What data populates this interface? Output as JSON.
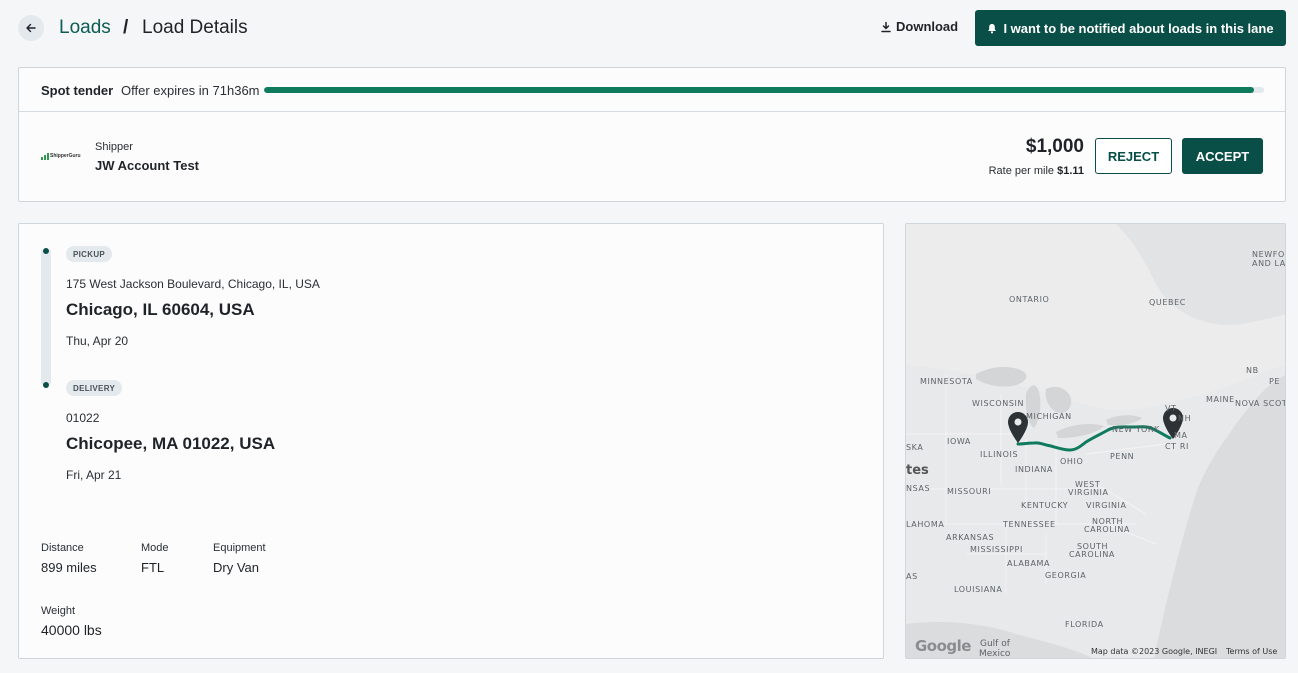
{
  "header": {
    "breadcrumb_loads": "Loads",
    "breadcrumb_separator": "/",
    "breadcrumb_current": "Load Details",
    "download_label": "Download",
    "notify_label": "I want to be notified about loads in this lane"
  },
  "tender": {
    "label": "Spot tender",
    "expires_text": "Offer expires in 71h36m",
    "progress_fraction": 0.99
  },
  "offer": {
    "shipper_caption": "Shipper",
    "shipper_name": "JW Account Test",
    "shipper_logo_text": "ShipperGuru",
    "price": "$1,000",
    "rate_label": "Rate per mile",
    "rate_value": "$1.11",
    "reject_label": "REJECT",
    "accept_label": "ACCEPT"
  },
  "stops": {
    "pickup": {
      "badge": "PICKUP",
      "address": "175 West Jackson Boulevard, Chicago, IL, USA",
      "city": "Chicago, IL 60604, USA",
      "date": "Thu, Apr 20"
    },
    "delivery": {
      "badge": "DELIVERY",
      "address": "01022",
      "city": "Chicopee, MA 01022, USA",
      "date": "Fri, Apr 21"
    }
  },
  "meta": {
    "distance_label": "Distance",
    "distance_value": "899 miles",
    "mode_label": "Mode",
    "mode_value": "FTL",
    "equipment_label": "Equipment",
    "equipment_value": "Dry Van",
    "weight_label": "Weight",
    "weight_value": "40000 lbs"
  },
  "map": {
    "labels": {
      "ontario": "ONTARIO",
      "quebec": "QUEBEC",
      "newfo": "NEWFO",
      "and_la": "AND LA",
      "minnesota": "MINNESOTA",
      "nb": "NB",
      "pe": "PE",
      "maine": "MAINE",
      "nova_scot": "NOVA SCOT",
      "wisconsin": "WISCONSIN",
      "michigan": "MICHIGAN",
      "vt": "VT",
      "nh": "NH",
      "new_york": "NEW YORK",
      "ma": "MA",
      "ska": "SKA",
      "iowa": "IOWA",
      "illinois": "ILLINOIS",
      "ohio": "OHIO",
      "penn": "PENN",
      "ct_ri": "CT RI",
      "tes": "tes",
      "indiana": "INDIANA",
      "nsas": "NSAS",
      "missouri": "MISSOURI",
      "west_virginia_1": "WEST",
      "west_virginia_2": "VIRGINIA",
      "kentucky": "KENTUCKY",
      "virginia": "VIRGINIA",
      "lahoma": "LAHOMA",
      "tennessee": "TENNESSEE",
      "north_carolina_1": "NORTH",
      "north_carolina_2": "CAROLINA",
      "arkansas": "ARKANSAS",
      "mississippi": "MISSISSIPPI",
      "south_carolina_1": "SOUTH",
      "south_carolina_2": "CAROLINA",
      "as": "AS",
      "alabama": "ALABAMA",
      "georgia": "GEORGIA",
      "louisiana": "LOUISIANA",
      "florida": "FLORIDA",
      "gulf_1": "Gulf of",
      "gulf_2": "Mexico"
    },
    "google_logo": "Google",
    "attribution": "Map data ©2023 Google, INEGI",
    "terms": "Terms of Use",
    "route_color": "#0e7a5e"
  },
  "colors": {
    "brand": "#0a4f47",
    "accent": "#0e7a5e"
  }
}
